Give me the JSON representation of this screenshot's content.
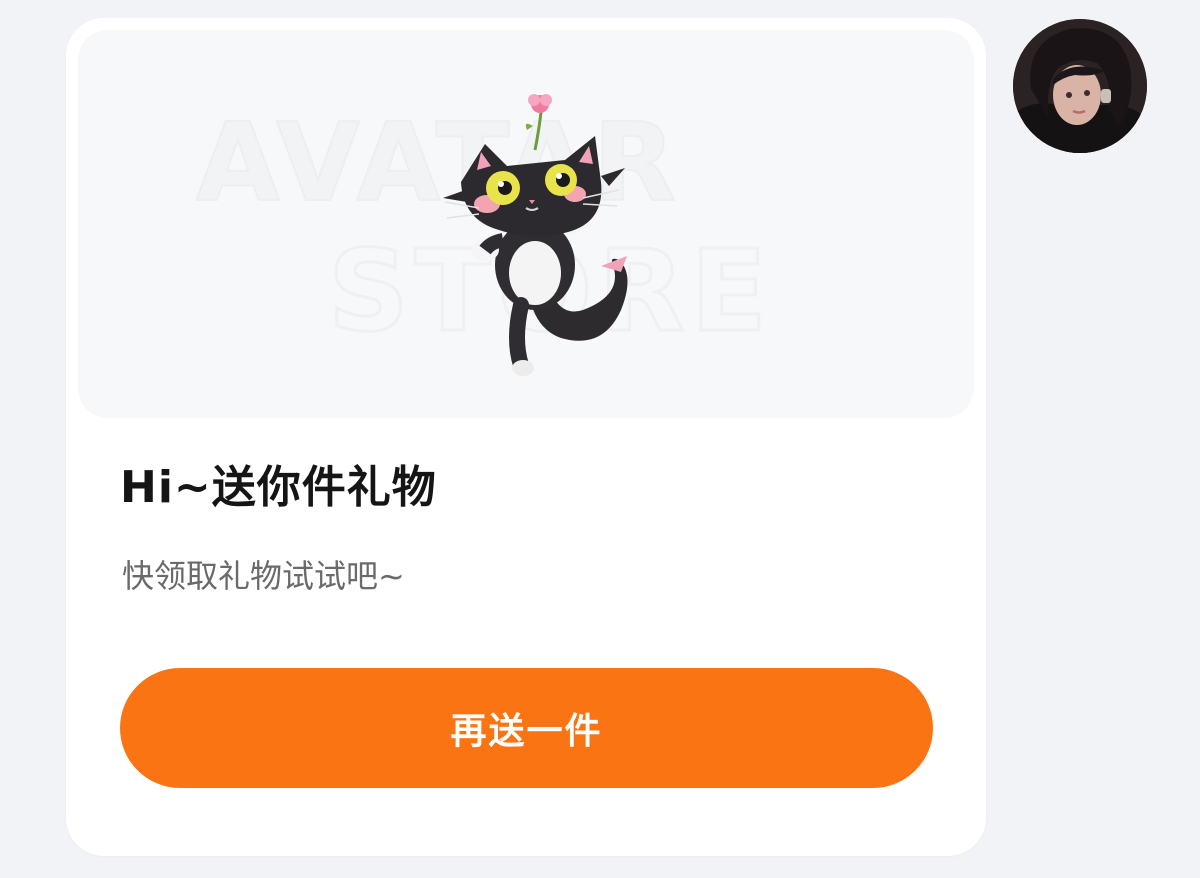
{
  "message_card": {
    "title": "Hi~送你件礼物",
    "subtitle": "快领取礼物试试吧~",
    "button_label": "再送一件",
    "watermark_lines": [
      "AVATAR",
      "STORE"
    ]
  },
  "sender_avatar": {
    "icon": "user-avatar-photo"
  },
  "colors": {
    "button": "#fb7414",
    "background": "#f1f3f6",
    "card": "#ffffff"
  }
}
